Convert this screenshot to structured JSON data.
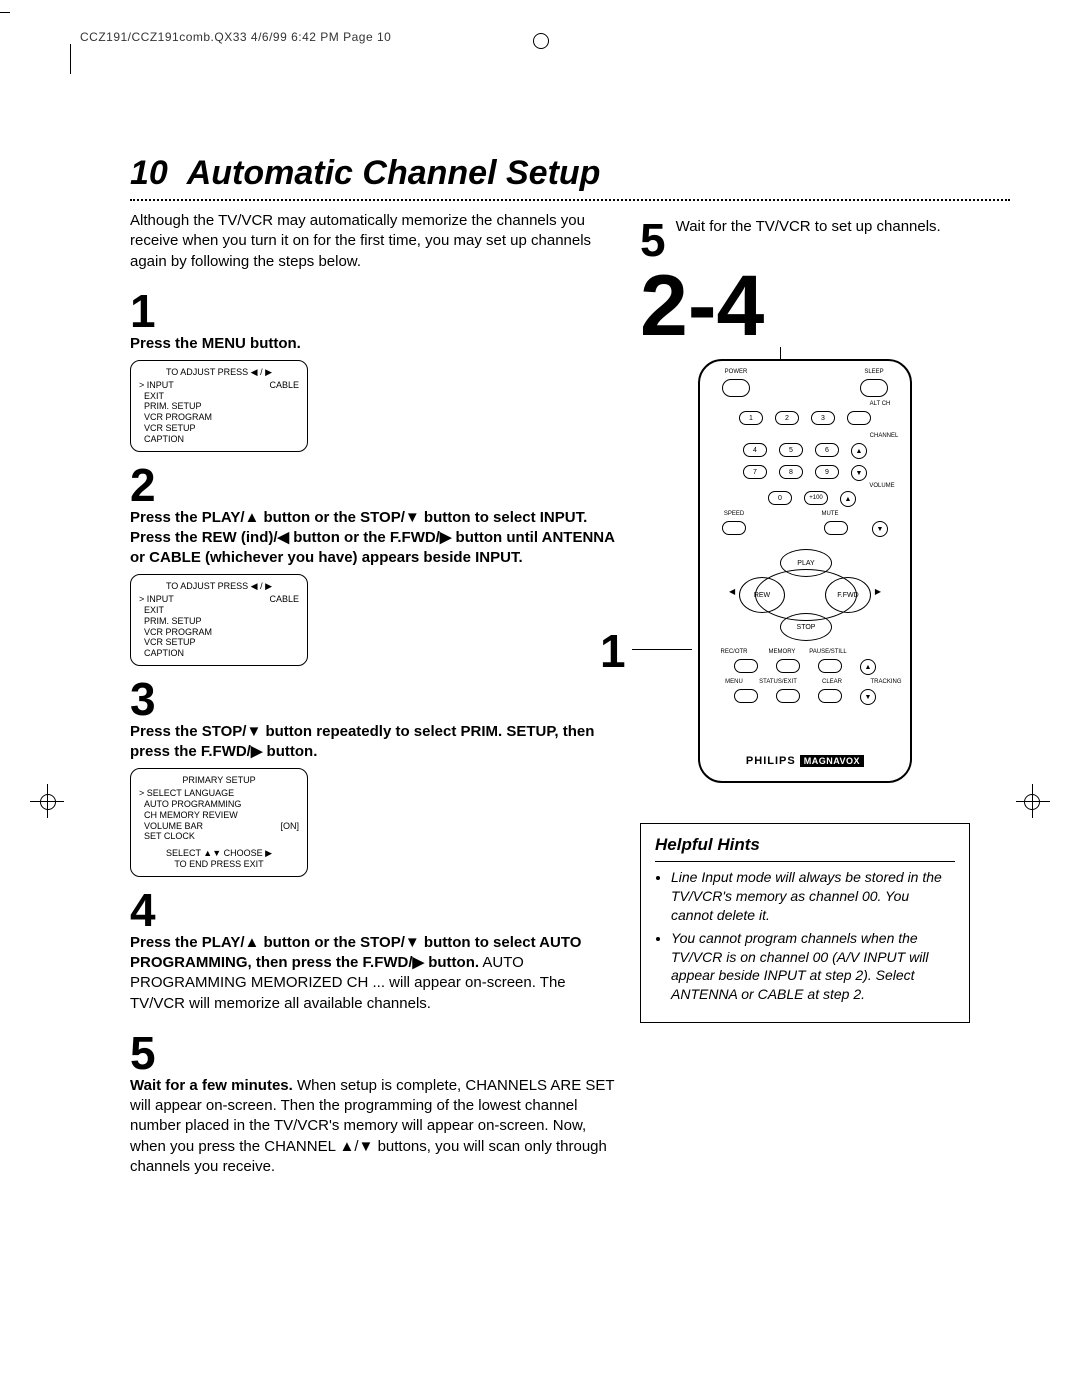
{
  "header": "CCZ191/CCZ191comb.QX33  4/6/99 6:42 PM  Page 10",
  "page_number": "10",
  "title": "Automatic Channel Setup",
  "intro": "Although the TV/VCR may automatically memorize the channels you receive when you turn it on for the first time, you may set up channels again by following the steps below.",
  "steps": {
    "s1": {
      "num": "1",
      "text": "Press the MENU button."
    },
    "s2": {
      "num": "2",
      "text_strong": "Press the PLAY/▲ button or the STOP/▼ button to select INPUT. Press the REW (ind)/◀ button or the F.FWD/▶ button until ANTENNA or CABLE (whichever you have) appears beside INPUT."
    },
    "s3": {
      "num": "3",
      "text_strong": "Press the STOP/▼ button repeatedly to select PRIM. SETUP, then press the F.FWD/▶ button."
    },
    "s4": {
      "num": "4",
      "text_strong": "Press the PLAY/▲ button or the STOP/▼ button to select AUTO PROGRAMMING, then press the F.FWD/▶ button.",
      "text_rest": " AUTO PROGRAMMING MEMORIZED CH ... will appear on-screen. The TV/VCR will memorize all available channels."
    },
    "s5": {
      "num": "5",
      "text_strong": "Wait for a few minutes.",
      "text_rest": " When setup is complete, CHANNELS ARE SET will appear on-screen. Then the programming of the lowest channel number placed in the TV/VCR's memory will appear on-screen. Now, when you press the CHANNEL ▲/▼ buttons, you will scan only through channels you receive."
    }
  },
  "osd1": {
    "title": "TO ADJUST PRESS ◀ / ▶",
    "items": [
      "INPUT",
      "EXIT",
      "PRIM. SETUP",
      "VCR PROGRAM",
      "VCR SETUP",
      "CAPTION"
    ],
    "right": "CABLE"
  },
  "osd2": {
    "title": "TO ADJUST PRESS ◀ / ▶",
    "items": [
      "INPUT",
      "EXIT",
      "PRIM. SETUP",
      "VCR PROGRAM",
      "VCR SETUP",
      "CAPTION"
    ],
    "right": "CABLE"
  },
  "osd3": {
    "title": "PRIMARY SETUP",
    "items": [
      "SELECT LANGUAGE",
      "AUTO PROGRAMMING",
      "CH MEMORY REVIEW",
      "VOLUME BAR",
      "SET CLOCK"
    ],
    "vb_state": "[ON]",
    "footer1": "SELECT ▲▼ CHOOSE ▶",
    "footer2": "TO END PRESS EXIT"
  },
  "right_col": {
    "big": "2-4",
    "step5_num": "5",
    "step5_text": "Wait for the TV/VCR to set up channels.",
    "callout1": "1"
  },
  "remote": {
    "power": "POWER",
    "sleep": "SLEEP",
    "altch": "ALT CH",
    "channel": "CHANNEL",
    "speed": "SPEED",
    "mute": "MUTE",
    "volume": "VOLUME",
    "play": "PLAY",
    "rew": "REW",
    "ffwd": "F.FWD",
    "stop": "STOP",
    "recotr": "REC/OTR",
    "memory": "MEMORY",
    "pause": "PAUSE/STILL",
    "menu": "MENU",
    "status": "STATUS/EXIT",
    "clear": "CLEAR",
    "tracking": "TRACKING",
    "n0": "0",
    "n1": "1",
    "n2": "2",
    "n3": "3",
    "n4": "4",
    "n5": "5",
    "n6": "6",
    "n7": "7",
    "n8": "8",
    "n9": "9",
    "n100": "+100",
    "brand1": "PHILIPS",
    "brand2": "MAGNAVOX"
  },
  "hints": {
    "title": "Helpful Hints",
    "h1": "Line Input mode will always be stored in the TV/VCR's memory as channel 00. You cannot delete it.",
    "h2": "You cannot program channels when the TV/VCR is on channel 00 (A/V INPUT will appear beside INPUT at step 2). Select ANTENNA or CABLE at step 2."
  }
}
